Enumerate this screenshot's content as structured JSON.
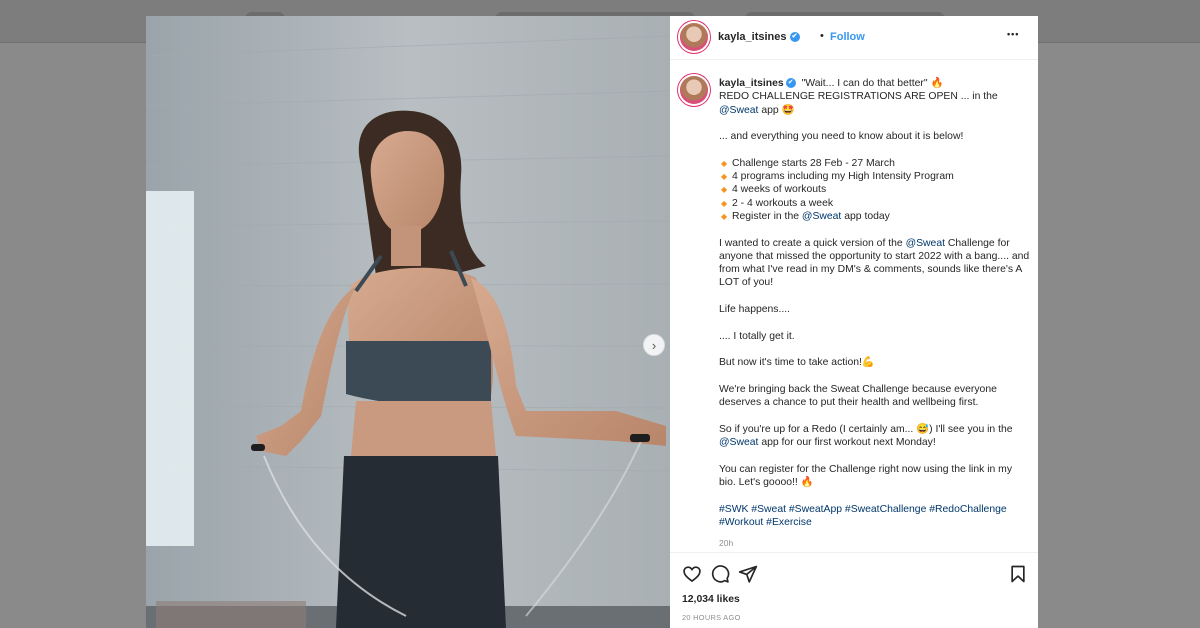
{
  "post": {
    "username": "kayla_itsines",
    "verified_mark": "✔",
    "dot": "•",
    "follow_label": "Follow",
    "more_label": "•••",
    "next_arrow": "›"
  },
  "caption": {
    "username": "kayla_itsines",
    "line1_rest": "\"Wait... I can do that better\" 🔥",
    "line2": "REDO CHALLENGE REGISTRATIONS ARE OPEN ... in the",
    "line3_mention": "@Sweat",
    "line3_rest": " app 🤩",
    "para2": "... and everything you need to know about it is below!",
    "bullet_glyph": "◆",
    "bullets": [
      {
        "pre": "Challenge starts 28 Feb - 27 March",
        "mention": "",
        "post": ""
      },
      {
        "pre": "4 programs including my High Intensity Program",
        "mention": "",
        "post": ""
      },
      {
        "pre": "4 weeks of workouts",
        "mention": "",
        "post": ""
      },
      {
        "pre": "2 - 4 workouts a week",
        "mention": "",
        "post": ""
      },
      {
        "pre": "Register in the ",
        "mention": "@Sweat",
        "post": " app today"
      }
    ],
    "para4_pre": "I wanted to create a quick version of the ",
    "para4_mention": "@Sweat",
    "para4_post": " Challenge for anyone that missed the opportunity to start 2022 with a bang.... and from what I've read in my DM's & comments, sounds like there's A LOT of you!",
    "para5": "Life happens....",
    "para6": ".... I totally get it.",
    "para7": "But now it's time to take action!💪",
    "para8": "We're bringing back the Sweat Challenge because everyone deserves a chance to put their health and wellbeing first.",
    "para9_pre": "So if you're up for a Redo (I certainly am... 😅) I'll see you in the ",
    "para9_mention": "@Sweat",
    "para9_post": " app for our first workout next Monday!",
    "para10": "You can register for the Challenge right now using the link in my bio. Let's goooo!! 🔥",
    "hashtags": "#SWK #Sweat #SweatApp #SweatChallenge #RedoChallenge #Workout #Exercise",
    "time": "20h"
  },
  "footer": {
    "likes": "12,034 likes",
    "ago": "20 HOURS AGO"
  },
  "colors": {
    "link": "#00376b",
    "follow": "#3897f0",
    "text": "#262626",
    "muted": "#8e8e8e"
  }
}
